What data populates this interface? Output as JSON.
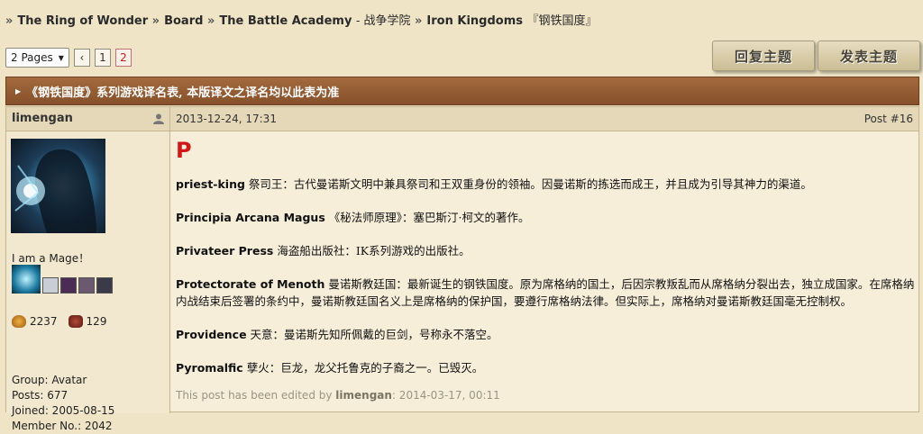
{
  "breadcrumb": {
    "items": [
      "The Ring of Wonder",
      "Board",
      "The Battle Academy",
      "Iron Kingdoms"
    ],
    "academy_cn": "- 战争学院",
    "kingdoms_cn": "『钢铁国度』"
  },
  "pagination": {
    "select_label": "2 Pages",
    "prev_label": "‹",
    "pages": [
      "1",
      "2"
    ],
    "current": "2"
  },
  "buttons": {
    "reply": "回复主题",
    "new_topic": "发表主题"
  },
  "topic_title": "《钢铁国度》系列游戏译名表, 本版译文之译名均以此表为准",
  "post": {
    "author": "limengan",
    "date": "2013-12-24, 17:31",
    "number": "Post #16",
    "user_title": "I am a Mage！",
    "stat1": "2237",
    "stat2": "129",
    "group": "Group: Avatar",
    "posts": "Posts: 677",
    "joined": "Joined: 2005-08-15",
    "member_no": "Member No.: 2042",
    "letter": "P",
    "entries": [
      {
        "term": "priest-king",
        "text": "祭司王：古代曼诺斯文明中兼具祭司和王双重身份的领袖。因曼诺斯的拣选而成王，并且成为引导其神力的渠道。"
      },
      {
        "term": "Principia Arcana Magus",
        "text": "《秘法师原理》：塞巴斯汀·柯文的著作。"
      },
      {
        "term": "Privateer Press",
        "text": "海盗船出版社：IK系列游戏的出版社。"
      },
      {
        "term": "Protectorate of Menoth",
        "text": "曼诺斯教廷国：最新诞生的钢铁国度。原为席格纳的国土，后因宗教叛乱而从席格纳分裂出去，独立成国家。在席格纳内战结束后签署的条约中，曼诺斯教廷国名义上是席格纳的保护国，要遵行席格纳法律。但实际上，席格纳对曼诺斯教廷国毫无控制权。"
      },
      {
        "term": "Providence",
        "text": "天意：曼诺斯先知所佩戴的巨剑，号称永不落空。"
      },
      {
        "term": "Pyromalfic",
        "text": "孽火：巨龙，龙父托鲁克的子裔之一。已毁灭。"
      }
    ],
    "edit_prefix": "This post has been edited by",
    "edit_user": "limengan",
    "edit_date": ": 2014-03-17, 00:11"
  },
  "colors": {
    "accent_red": "#d01818",
    "topic_bar": "#8f5a33",
    "background": "#efe4c6"
  }
}
